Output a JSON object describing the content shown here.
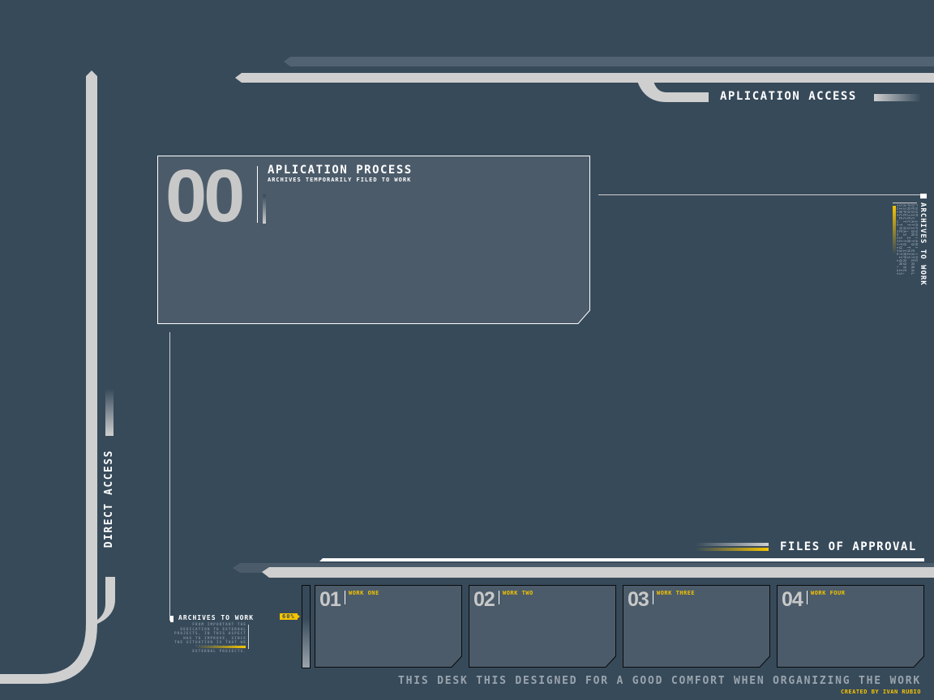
{
  "header": {
    "section_label": "APLICATION ACCESS"
  },
  "main_panel": {
    "number": "00",
    "title": "APLICATION PROCESS",
    "subtitle": "ARCHIVES TEMPORARILY FILED TO WORK"
  },
  "right_sidebar": {
    "title": "ARCHIVES TO WORK",
    "body": "FROM IMPORTANT THE DEDICATION TO EXTERNAL PROJECTS, IN THIS ASPECT HAS TO IMPROVE, SINCE THE SITUATION IS THAT WE DEDICATE A LOT TO EXTERNAL PROJECTS."
  },
  "left_sidebar": {
    "label": "DIRECT ACCESS"
  },
  "bottom_archives": {
    "title": "ARCHIVES TO WORK",
    "body": "FROM IMPORTANT THE DEDICATION TO EXTERNAL PROJECTS, IN THIS ASPECT HAS TO IMPROVE, SINCE THE SITUATION IS THAT WE DEDICATE A LOT TO EXTERNAL PROJECTS."
  },
  "progress": {
    "label": "60%",
    "value_percent": 60
  },
  "files_of_approval": {
    "label": "FILES OF APPROVAL",
    "cards": [
      {
        "number": "01",
        "label": "WORK ONE"
      },
      {
        "number": "02",
        "label": "WORK TWO"
      },
      {
        "number": "03",
        "label": "WORK THREE"
      },
      {
        "number": "04",
        "label": "WORK FOUR"
      }
    ]
  },
  "footer": {
    "tagline": "THIS DESK THIS DESIGNED FOR A GOOD COMFORT WHEN ORGANIZING THE WORK",
    "credit": "CREATED BY IVAN RUBIO"
  },
  "colors": {
    "background": "#374a5a",
    "panel": "#4b5b6a",
    "bar_light": "#cfcfcf",
    "bar_dark": "#516372",
    "accent_yellow": "#f5c400",
    "text_white": "#ffffff"
  }
}
